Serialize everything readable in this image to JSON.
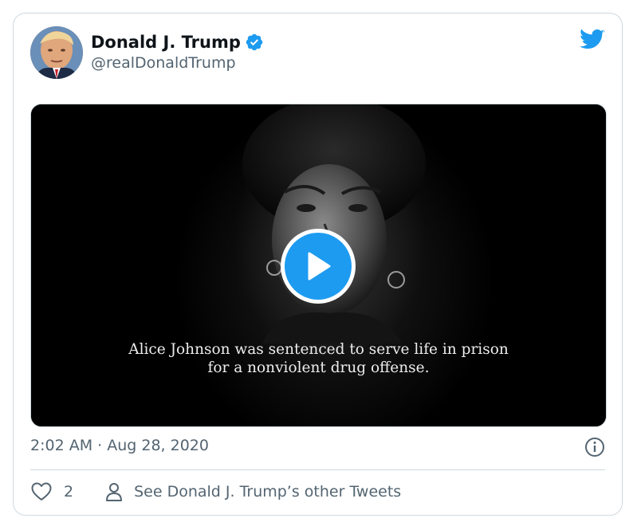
{
  "tweet": {
    "author": {
      "display_name": "Donald J. Trump",
      "handle": "@realDonaldTrump",
      "verified": true
    },
    "media": {
      "type": "video",
      "caption_line1": "Alice Johnson was sentenced to serve life in prison",
      "caption_line2": "for a nonviolent drug offense."
    },
    "timestamp": "2:02 AM · Aug 28, 2020",
    "like_count": "2",
    "profile_link_label": "See Donald J. Trump’s other Tweets"
  },
  "colors": {
    "brand_blue": "#1d9bf0",
    "text_primary": "#0f1419",
    "text_secondary": "#536471",
    "border": "#cfd9de"
  },
  "icons": {
    "brand": "twitter-bird-icon",
    "verified": "verified-badge-icon",
    "play": "play-icon",
    "info": "info-icon",
    "like": "heart-icon",
    "profile": "person-icon"
  }
}
